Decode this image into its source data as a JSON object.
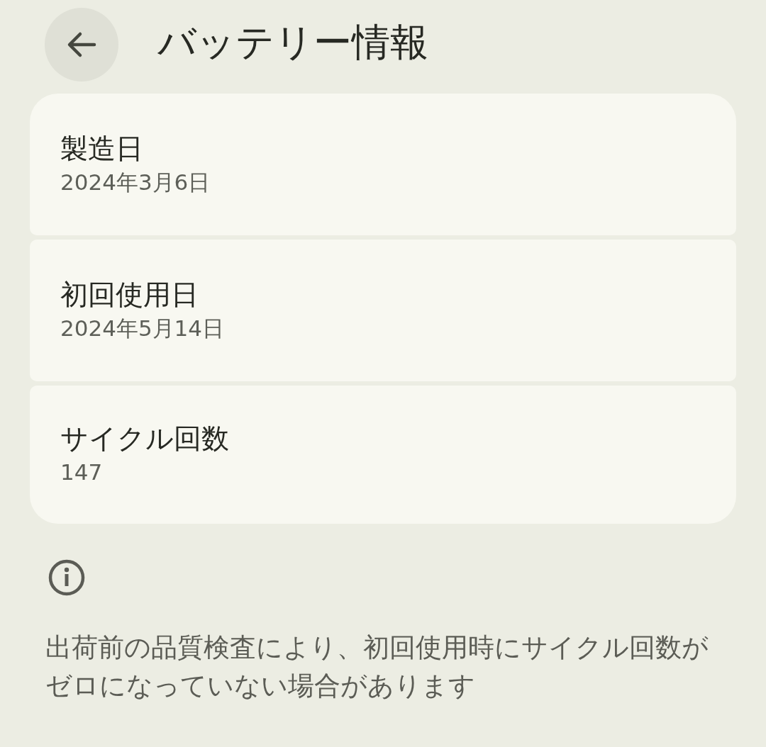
{
  "header": {
    "title": "バッテリー情報"
  },
  "items": [
    {
      "label": "製造日",
      "value": "2024年3月6日"
    },
    {
      "label": "初回使用日",
      "value": "2024年5月14日"
    },
    {
      "label": "サイクル回数",
      "value": "147"
    }
  ],
  "note": {
    "text": "出荷前の品質検査により、初回使用時にサイクル回数がゼロになっていない場合があります"
  }
}
